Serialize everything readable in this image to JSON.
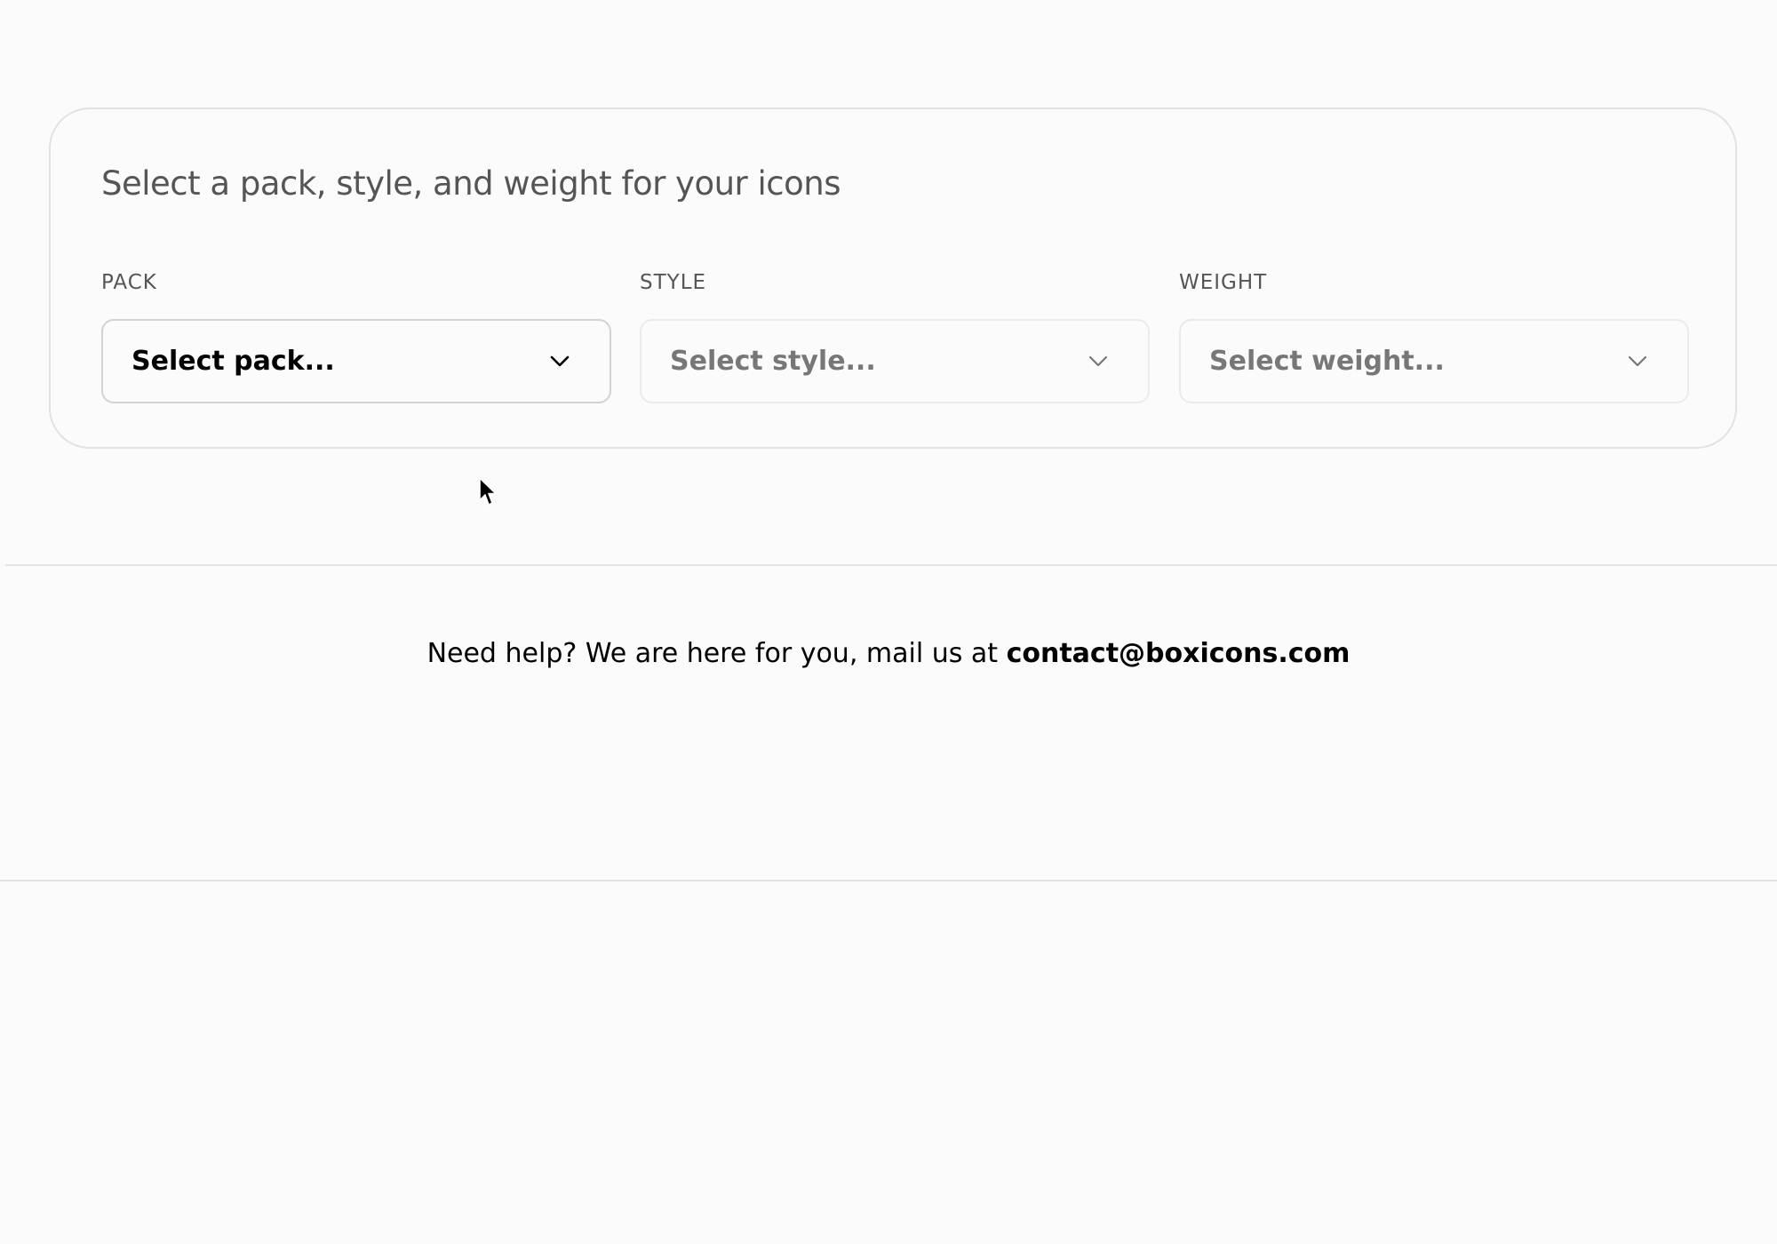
{
  "card": {
    "title": "Select a pack, style, and weight for your icons"
  },
  "fields": {
    "pack": {
      "label": "PACK",
      "value": "Select pack..."
    },
    "style": {
      "label": "STYLE",
      "value": "Select style..."
    },
    "weight": {
      "label": "WEIGHT",
      "value": "Select weight..."
    }
  },
  "help": {
    "text": "Need help? We are here for you, mail us at ",
    "email": "contact@boxicons.com"
  },
  "icons": {
    "chevron": "chevron-down-icon",
    "cursor": "mouse-pointer-icon"
  },
  "colors": {
    "background": "#fbfbfb",
    "border": "#e2e2e2",
    "muted_text": "#555555",
    "placeholder_text": "#777777",
    "active_text": "#000000"
  }
}
